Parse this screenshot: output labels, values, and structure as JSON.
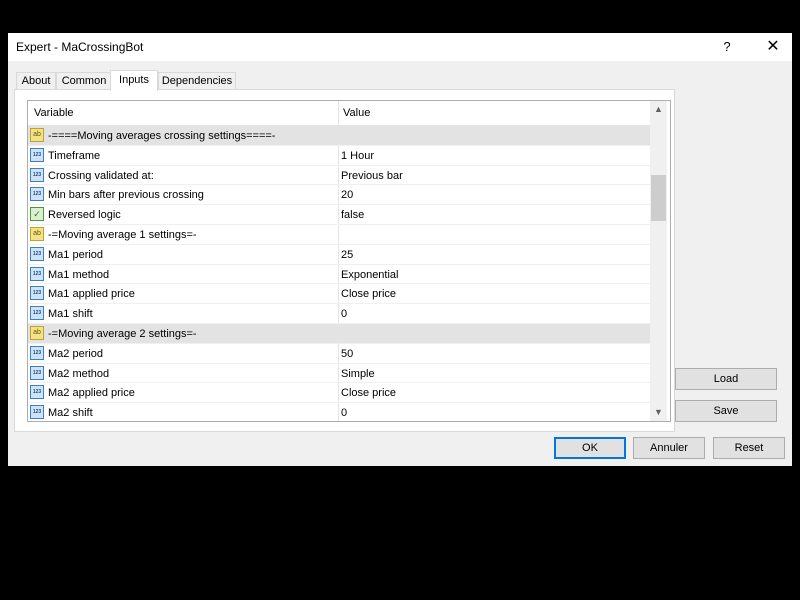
{
  "window": {
    "title": "Expert - MaCrossingBot",
    "help_glyph": "?",
    "close_glyph": "✕"
  },
  "tabs": [
    {
      "label": "About"
    },
    {
      "label": "Common"
    },
    {
      "label": "Inputs",
      "active": true
    },
    {
      "label": "Dependencies"
    }
  ],
  "grid": {
    "columns": {
      "variable": "Variable",
      "value": "Value"
    },
    "rows": [
      {
        "type": "string",
        "icon": "ab-icon",
        "name": "-====Moving averages crossing settings====-",
        "value": "",
        "group": true
      },
      {
        "type": "number",
        "icon": "123-icon",
        "name": "Timeframe",
        "value": "1 Hour"
      },
      {
        "type": "number",
        "icon": "123-icon",
        "name": "Crossing validated at:",
        "value": "Previous bar"
      },
      {
        "type": "number",
        "icon": "123-icon",
        "name": "Min bars after previous crossing",
        "value": "20"
      },
      {
        "type": "bool",
        "icon": "bool-icon",
        "name": "Reversed logic",
        "value": "false"
      },
      {
        "type": "string",
        "icon": "ab-icon",
        "name": "-=Moving average 1 settings=-",
        "value": ""
      },
      {
        "type": "number",
        "icon": "123-icon",
        "name": "Ma1 period",
        "value": "25"
      },
      {
        "type": "number",
        "icon": "123-icon",
        "name": "Ma1 method",
        "value": "Exponential"
      },
      {
        "type": "number",
        "icon": "123-icon",
        "name": "Ma1 applied price",
        "value": "Close price"
      },
      {
        "type": "number",
        "icon": "123-icon",
        "name": "Ma1 shift",
        "value": "0"
      },
      {
        "type": "string",
        "icon": "ab-icon",
        "name": "-=Moving average 2 settings=-",
        "value": "",
        "group": true
      },
      {
        "type": "number",
        "icon": "123-icon",
        "name": "Ma2 period",
        "value": "50"
      },
      {
        "type": "number",
        "icon": "123-icon",
        "name": "Ma2 method",
        "value": "Simple"
      },
      {
        "type": "number",
        "icon": "123-icon",
        "name": "Ma2 applied price",
        "value": "Close price"
      },
      {
        "type": "number",
        "icon": "123-icon",
        "name": "Ma2 shift",
        "value": "0"
      }
    ]
  },
  "side_buttons": {
    "load": "Load",
    "save": "Save"
  },
  "footer_buttons": {
    "ok": "OK",
    "cancel": "Annuler",
    "reset": "Reset"
  },
  "colors": {
    "group_row_bg": "#e3e3e3",
    "default_button_border": "#0078d7",
    "window_bg": "#f0f0f0"
  }
}
